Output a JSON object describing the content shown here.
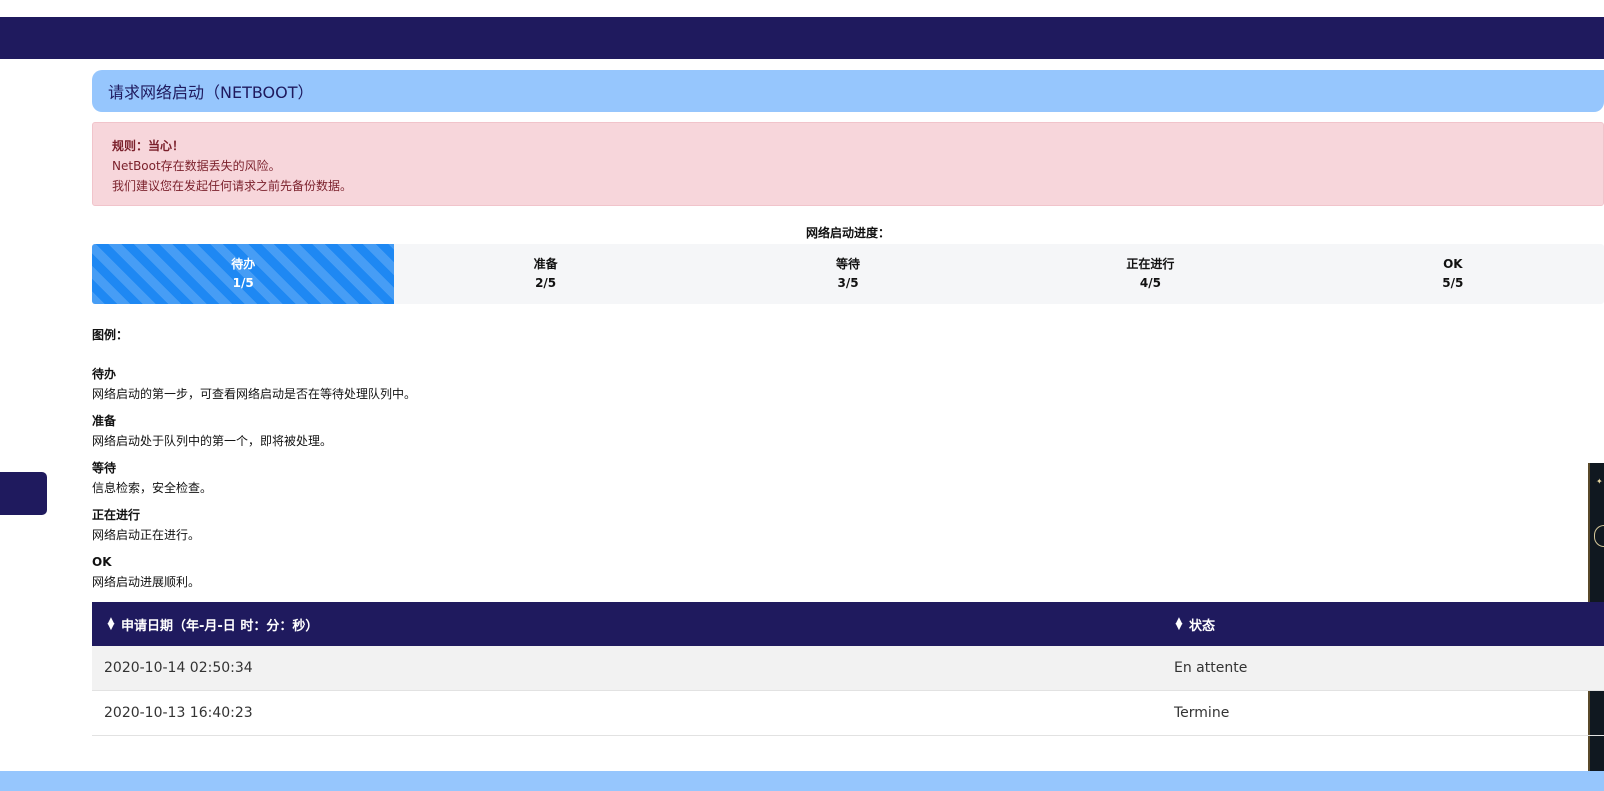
{
  "page": {
    "title": "请求网络启动（NETBOOT）"
  },
  "alert": {
    "title": "规则：当心！",
    "line1": "NetBoot存在数据丢失的风险。",
    "line2": "我们建议您在发起任何请求之前先备份数据。"
  },
  "progress": {
    "label": "网络启动进度：",
    "steps": [
      {
        "name": "待办",
        "count": "1/5"
      },
      {
        "name": "准备",
        "count": "2/5"
      },
      {
        "name": "等待",
        "count": "3/5"
      },
      {
        "name": "正在进行",
        "count": "4/5"
      },
      {
        "name": "OK",
        "count": "5/5"
      }
    ],
    "current_step": 1
  },
  "legend": {
    "title": "图例：",
    "items": [
      {
        "name": "待办",
        "desc": "网络启动的第一步，可查看网络启动是否在等待处理队列中。"
      },
      {
        "name": "准备",
        "desc": "网络启动处于队列中的第一个，即将被处理。"
      },
      {
        "name": "等待",
        "desc": "信息检索，安全检查。"
      },
      {
        "name": "正在进行",
        "desc": "网络启动正在进行。"
      },
      {
        "name": "OK",
        "desc": "网络启动进展顺利。"
      }
    ]
  },
  "table": {
    "headers": [
      "申请日期（年-月-日 时：分：秒）",
      "状态"
    ],
    "rows": [
      [
        "2020-10-14 02:50:34",
        "En attente"
      ],
      [
        "2020-10-13 16:40:23",
        "Termine"
      ]
    ]
  },
  "colors": {
    "navy": "#1f1a5e",
    "light_blue": "#96c6fd",
    "progress_active": "#1e88f3",
    "alert_bg": "#f7d6db"
  },
  "icons": {
    "sort": "sort-icon"
  }
}
